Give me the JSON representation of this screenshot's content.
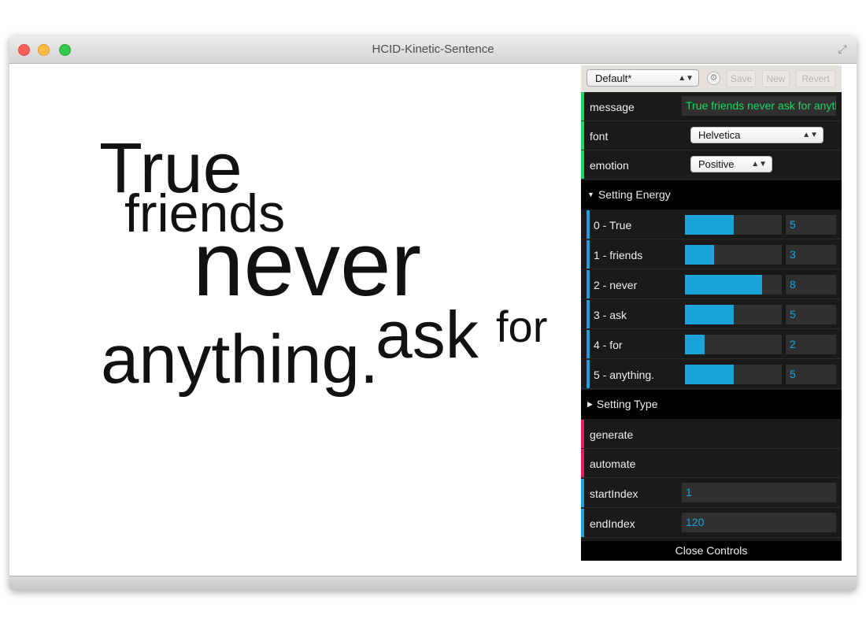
{
  "window": {
    "title": "HCID-Kinetic-Sentence"
  },
  "sentence": {
    "words": [
      "True",
      "friends",
      "never",
      "ask",
      "for",
      "anything."
    ]
  },
  "controls": {
    "preset": {
      "selected": "Default*",
      "save_label": "Save",
      "new_label": "New",
      "revert_label": "Revert"
    },
    "message": {
      "label": "message",
      "value": "True friends never ask for anything."
    },
    "font": {
      "label": "font",
      "value": "Helvetica"
    },
    "emotion": {
      "label": "emotion",
      "value": "Positive"
    },
    "setting_energy": {
      "label": "Setting Energy",
      "max": 10,
      "sliders": [
        {
          "label": "0 - True",
          "value": 5
        },
        {
          "label": "1 - friends",
          "value": 3
        },
        {
          "label": "2 - never",
          "value": 8
        },
        {
          "label": "3 - ask",
          "value": 5
        },
        {
          "label": "4 - for",
          "value": 2
        },
        {
          "label": "5 - anything.",
          "value": 5
        }
      ]
    },
    "setting_type": {
      "label": "Setting Type"
    },
    "generate": {
      "label": "generate"
    },
    "automate": {
      "label": "automate"
    },
    "start_index": {
      "label": "startIndex",
      "value": "1"
    },
    "end_index": {
      "label": "endIndex",
      "value": "120"
    },
    "close_label": "Close Controls"
  },
  "colors": {
    "accent_blue": "#1aa3d9",
    "accent_green": "#1ed760",
    "accent_pink": "#e61d5f",
    "panel_bg": "#1a1a1a"
  }
}
